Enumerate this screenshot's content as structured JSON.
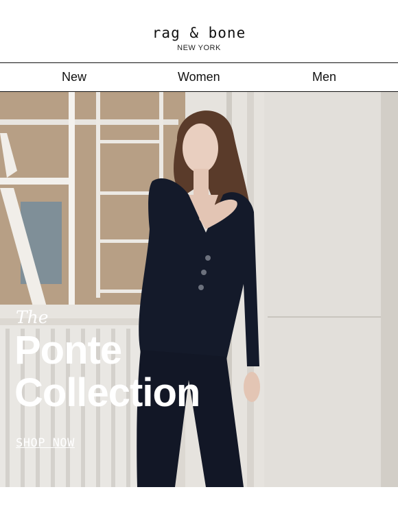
{
  "brand": {
    "name": "rag & bone",
    "location": "NEW YORK"
  },
  "nav": {
    "items": [
      {
        "label": "New"
      },
      {
        "label": "Women"
      },
      {
        "label": "Men"
      }
    ]
  },
  "hero": {
    "eyebrow": "The",
    "title_line1": "Ponte",
    "title_line2": "Collection",
    "cta": "SHOP NOW"
  },
  "colors": {
    "text": "#111111",
    "hero_text": "#ffffff",
    "outfit": "#141a2a"
  }
}
